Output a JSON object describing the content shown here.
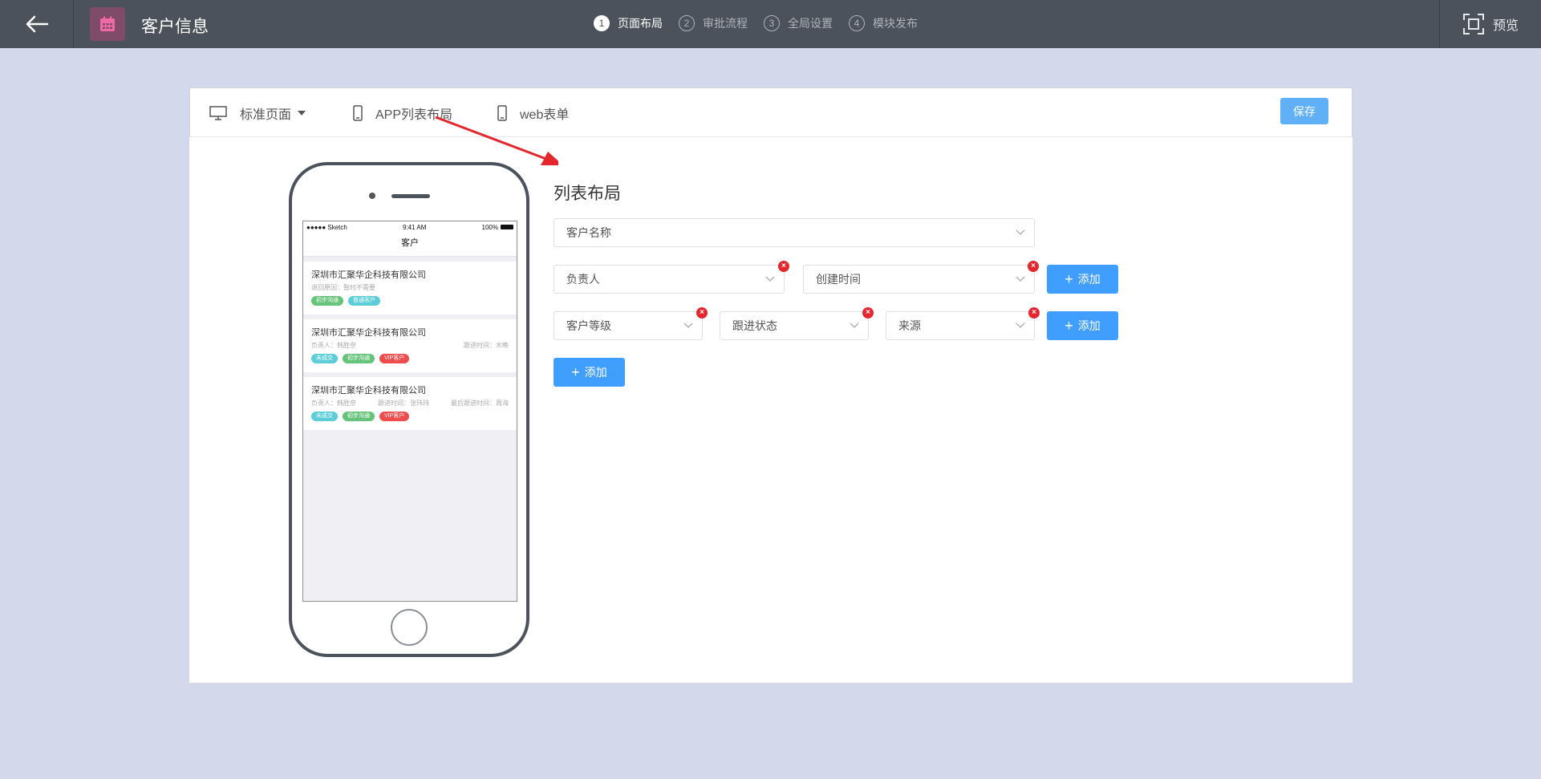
{
  "header": {
    "title": "客户信息",
    "steps": [
      {
        "num": "1",
        "label": "页面布局"
      },
      {
        "num": "2",
        "label": "审批流程"
      },
      {
        "num": "3",
        "label": "全局设置"
      },
      {
        "num": "4",
        "label": "模块发布"
      }
    ],
    "preview_label": "预览"
  },
  "toolbar": {
    "standard_page": "标准页面",
    "app_list_layout": "APP列表布局",
    "web_form": "web表单",
    "save_label": "保存"
  },
  "phone": {
    "status_left": "●●●●● Sketch",
    "status_time": "9:41 AM",
    "status_battery": "100%",
    "nav_title": "客户",
    "cards": [
      {
        "title": "深圳市汇聚华企科技有限公司",
        "meta_left": "退回原因：暂时不需要",
        "meta_mid": "",
        "meta_right": "",
        "tags": [
          {
            "label": "初步沟通",
            "color": "#65c47a"
          },
          {
            "label": "普通客户",
            "color": "#5ccdd9"
          }
        ]
      },
      {
        "title": "深圳市汇聚华企科技有限公司",
        "meta_left": "负责人：韩胜奈",
        "meta_mid": "",
        "meta_right": "跟进时间：木晚",
        "tags": [
          {
            "label": "未成交",
            "color": "#5ccdd9"
          },
          {
            "label": "初步沟通",
            "color": "#65c47a"
          },
          {
            "label": "VIP客户",
            "color": "#ef4d4d"
          }
        ]
      },
      {
        "title": "深圳市汇聚华企科技有限公司",
        "meta_left": "负责人：韩胜奈",
        "meta_mid": "跟进时间：张玮玮",
        "meta_right": "最后跟进时间：周海",
        "tags": [
          {
            "label": "未成交",
            "color": "#5ccdd9"
          },
          {
            "label": "初步沟通",
            "color": "#65c47a"
          },
          {
            "label": "VIP客户",
            "color": "#ef4d4d"
          }
        ]
      }
    ]
  },
  "layout": {
    "title": "列表布局",
    "row1": {
      "field": "客户名称"
    },
    "row2": {
      "fields": [
        "负责人",
        "创建时间"
      ],
      "add_label": "添加"
    },
    "row3": {
      "fields": [
        "客户等级",
        "跟进状态",
        "来源"
      ],
      "add_label": "添加"
    },
    "add_row_label": "添加"
  },
  "colors": {
    "topbar": "#4b525b",
    "background": "#d3d8ea",
    "primary": "#409eff",
    "danger": "#e5262d",
    "app_icon": "#7e4c68"
  }
}
